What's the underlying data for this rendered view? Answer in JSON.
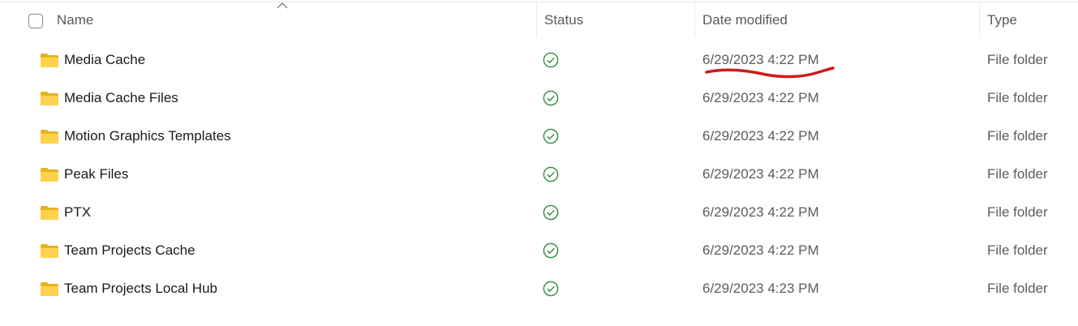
{
  "header": {
    "name_label": "Name",
    "status_label": "Status",
    "date_label": "Date modified",
    "type_label": "Type"
  },
  "rows": [
    {
      "name": "Media Cache",
      "status_icon": "synced-check-icon",
      "date": "6/29/2023 4:22 PM",
      "type": "File folder"
    },
    {
      "name": "Media Cache Files",
      "status_icon": "synced-check-icon",
      "date": "6/29/2023 4:22 PM",
      "type": "File folder"
    },
    {
      "name": "Motion Graphics Templates",
      "status_icon": "synced-check-icon",
      "date": "6/29/2023 4:22 PM",
      "type": "File folder"
    },
    {
      "name": "Peak Files",
      "status_icon": "synced-check-icon",
      "date": "6/29/2023 4:22 PM",
      "type": "File folder"
    },
    {
      "name": "PTX",
      "status_icon": "synced-check-icon",
      "date": "6/29/2023 4:22 PM",
      "type": "File folder"
    },
    {
      "name": "Team Projects Cache",
      "status_icon": "synced-check-icon",
      "date": "6/29/2023 4:22 PM",
      "type": "File folder"
    },
    {
      "name": "Team Projects Local Hub",
      "status_icon": "synced-check-icon",
      "date": "6/29/2023 4:23 PM",
      "type": "File folder"
    }
  ],
  "colors": {
    "folder": "#f4c430",
    "folder_front": "#ffd95a",
    "status_check": "#2e8b3e",
    "annotation": "#d11a1a"
  },
  "icons": {
    "folder": "folder-icon",
    "sort": "sort-ascending-icon",
    "status": "synced-check-icon"
  }
}
